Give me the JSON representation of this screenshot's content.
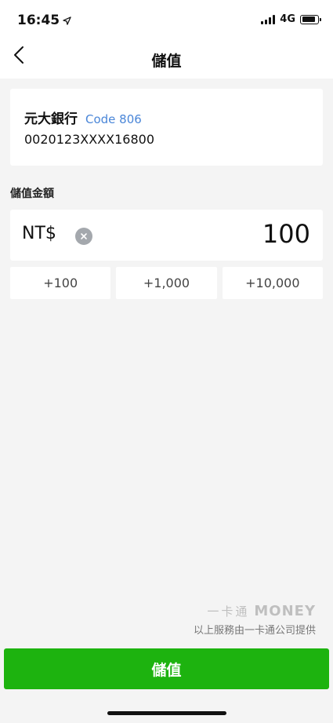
{
  "status_bar": {
    "time": "16:45",
    "network": "4G",
    "icons": [
      "location-arrow-icon",
      "signal-icon",
      "battery-icon"
    ]
  },
  "nav": {
    "back_icon": "chevron-left-icon",
    "title": "儲值"
  },
  "bank": {
    "name": "元大銀行",
    "code": "Code 806",
    "account_number": "0020123XXXX16800"
  },
  "amount": {
    "section_label": "儲值金額",
    "currency": "NT$",
    "clear_icon": "clear-icon",
    "value": "100"
  },
  "quick_amounts": [
    "+100",
    "+1,000",
    "+10,000"
  ],
  "provider": {
    "logo_cn": "一卡通",
    "logo_en": "MONEY",
    "note": "以上服務由一卡通公司提供"
  },
  "submit_label": "儲值",
  "colors": {
    "accent_green": "#1db30f",
    "code_blue": "#4a86d8",
    "background": "#f4f4f4"
  }
}
